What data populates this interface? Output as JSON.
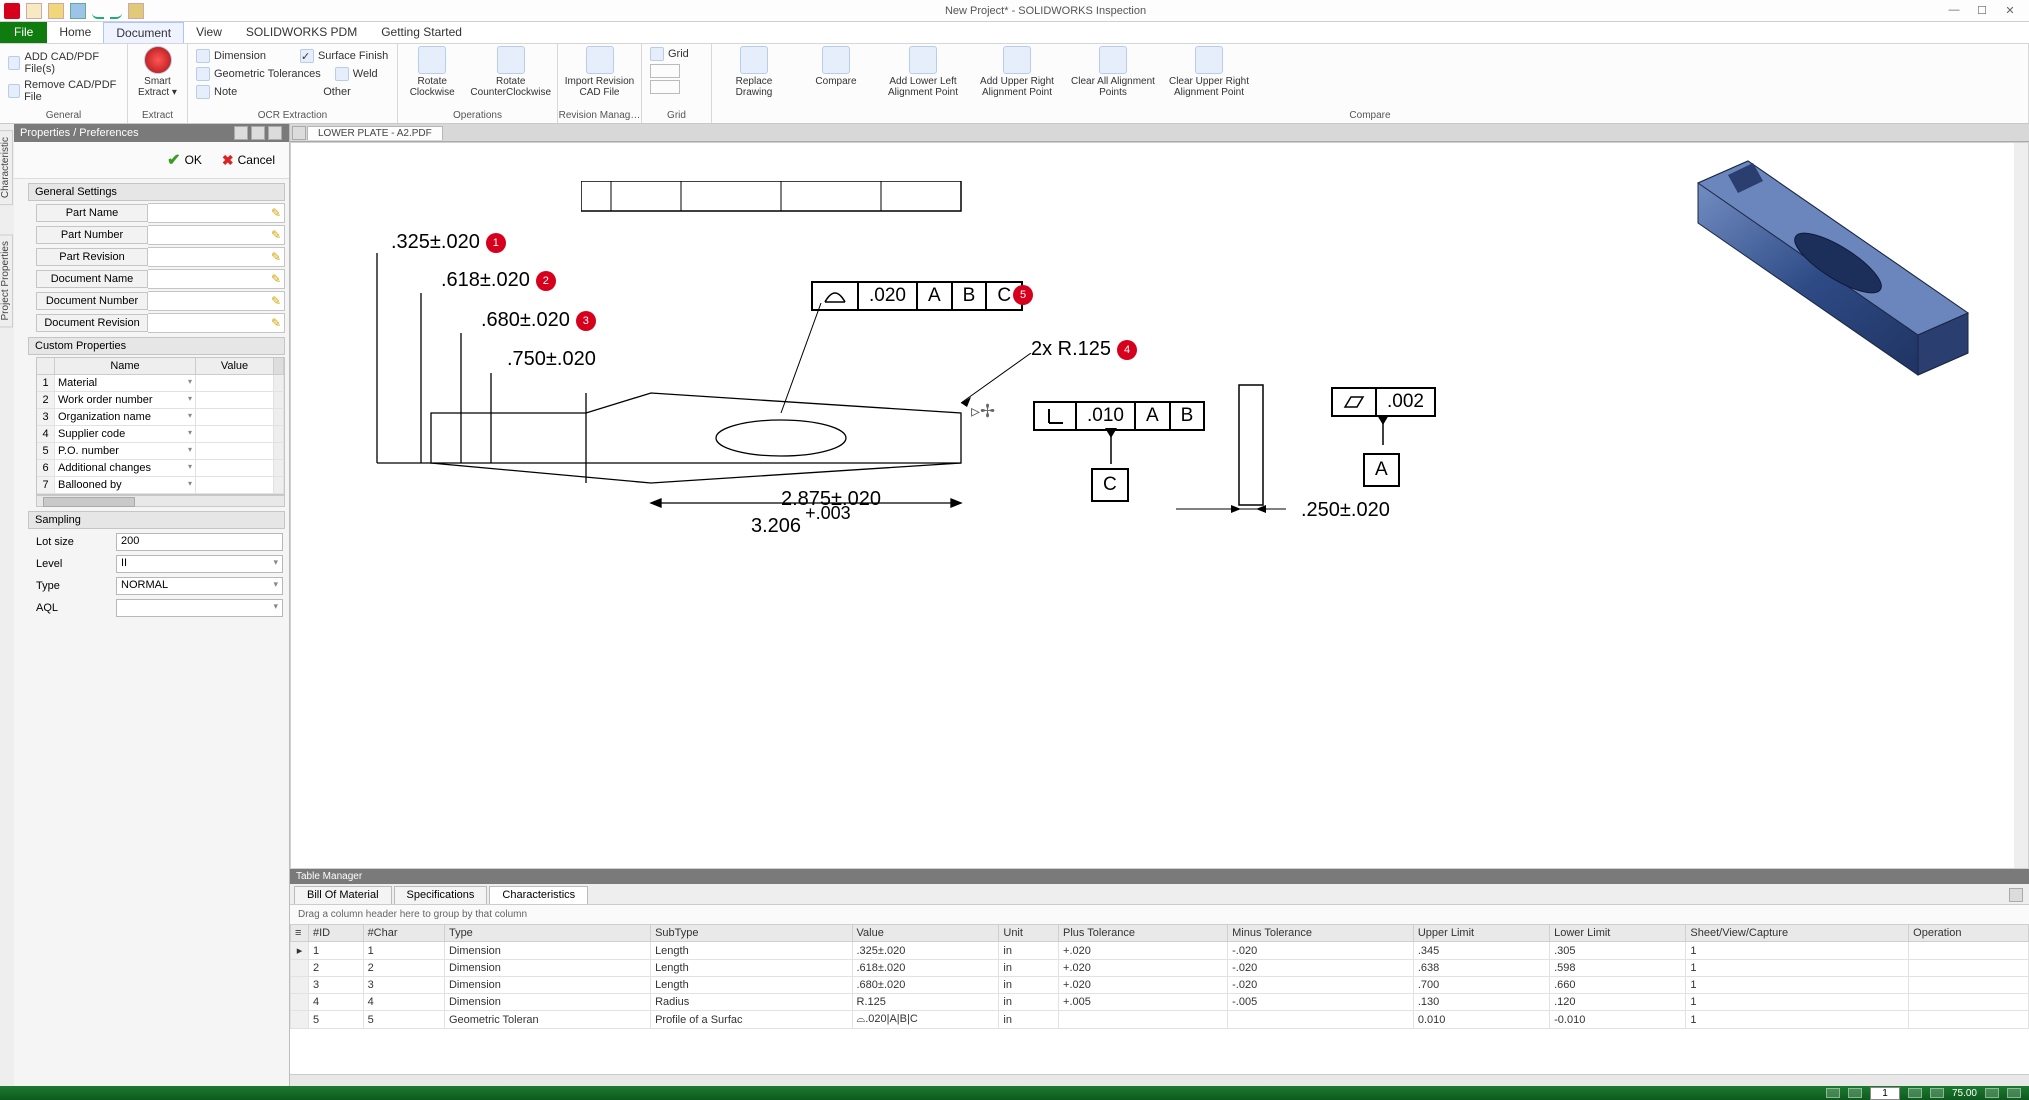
{
  "title": "New Project* - SOLIDWORKS Inspection",
  "menu": {
    "file": "File",
    "home": "Home",
    "document": "Document",
    "view": "View",
    "pdm": "SOLIDWORKS PDM",
    "getting_started": "Getting Started"
  },
  "ribbon": {
    "general": {
      "label": "General",
      "add": "ADD CAD/PDF File(s)",
      "remove": "Remove CAD/PDF File"
    },
    "extract": {
      "label": "Extract",
      "smart": "Smart Extract ▾"
    },
    "ocr": {
      "label": "OCR Extraction",
      "dimension": "Dimension",
      "geo": "Geometric Tolerances",
      "note": "Note",
      "surface": "Surface Finish",
      "weld": "Weld",
      "other": "Other"
    },
    "operations": {
      "label": "Operations",
      "rot_cw": "Rotate Clockwise",
      "rot_ccw": "Rotate CounterClockwise"
    },
    "revmgr": {
      "label": "Revision Manag…",
      "import": "Import Revision CAD File"
    },
    "grid": {
      "label": "Grid",
      "grid": "Grid"
    },
    "compare": {
      "label": "Compare",
      "replace": "Replace Drawing",
      "compare": "Compare",
      "addll": "Add Lower Left Alignment Point",
      "addur": "Add Upper Right Alignment Point",
      "clear": "Clear All Alignment Points",
      "clearur": "Clear Upper Right Alignment Point"
    }
  },
  "properties_header": "Properties / Preferences",
  "ok": "OK",
  "cancel": "Cancel",
  "general_settings": {
    "header": "General Settings",
    "fields": [
      "Part Name",
      "Part Number",
      "Part Revision",
      "Document Name",
      "Document Number",
      "Document Revision"
    ]
  },
  "custom_props": {
    "header": "Custom Properties",
    "cols": {
      "name": "Name",
      "value": "Value"
    },
    "rows": [
      "Material",
      "Work order number",
      "Organization name",
      "Supplier code",
      "P.O. number",
      "Additional changes",
      "Ballooned by"
    ]
  },
  "sampling": {
    "header": "Sampling",
    "lot": "Lot size",
    "lot_val": "200",
    "level": "Level",
    "level_val": "II",
    "type": "Type",
    "type_val": "NORMAL",
    "aql": "AQL"
  },
  "doc_tab": "LOWER PLATE - A2.PDF",
  "vtabs": {
    "char": "Characteristic",
    "proj": "Project Properties"
  },
  "drawing": {
    "d1": ".325±.020",
    "d2": ".618±.020",
    "d3": ".680±.020",
    "d4": ".750±.020",
    "d5": "2.875±.020",
    "d6_pre": "3.206",
    "d6_tol": "+.003",
    "d7": "2x R.125",
    "d8": ".250±.020",
    "fcf1_val": ".020",
    "fcf2_val": ".010",
    "fcf3_val": ".002",
    "A": "A",
    "B": "B",
    "C": "C"
  },
  "table_manager": {
    "title": "Table Manager",
    "tabs": {
      "bom": "Bill Of Material",
      "specs": "Specifications",
      "chars": "Characteristics"
    },
    "hint": "Drag a column header here to group by that column",
    "cols": [
      "#ID",
      "#Char",
      "Type",
      "SubType",
      "Value",
      "Unit",
      "Plus Tolerance",
      "Minus Tolerance",
      "Upper Limit",
      "Lower Limit",
      "Sheet/View/Capture",
      "Operation"
    ],
    "rows": [
      {
        "id": "1",
        "char": "1",
        "type": "Dimension",
        "sub": "Length",
        "val": ".325±.020",
        "unit": "in",
        "plus": "+.020",
        "minus": "-.020",
        "ul": ".345",
        "ll": ".305",
        "sheet": "1",
        "op": ""
      },
      {
        "id": "2",
        "char": "2",
        "type": "Dimension",
        "sub": "Length",
        "val": ".618±.020",
        "unit": "in",
        "plus": "+.020",
        "minus": "-.020",
        "ul": ".638",
        "ll": ".598",
        "sheet": "1",
        "op": ""
      },
      {
        "id": "3",
        "char": "3",
        "type": "Dimension",
        "sub": "Length",
        "val": ".680±.020",
        "unit": "in",
        "plus": "+.020",
        "minus": "-.020",
        "ul": ".700",
        "ll": ".660",
        "sheet": "1",
        "op": ""
      },
      {
        "id": "4",
        "char": "4",
        "type": "Dimension",
        "sub": "Radius",
        "val": "R.125",
        "unit": "in",
        "plus": "+.005",
        "minus": "-.005",
        "ul": ".130",
        "ll": ".120",
        "sheet": "1",
        "op": ""
      },
      {
        "id": "5",
        "char": "5",
        "type": "Geometric Toleran",
        "sub": "Profile of a Surfac",
        "val": "⌓.020|A|B|C",
        "unit": "in",
        "plus": "",
        "minus": "",
        "ul": "0.010",
        "ll": "-0.010",
        "sheet": "1",
        "op": ""
      }
    ]
  },
  "status": {
    "zoom": "75.00"
  }
}
